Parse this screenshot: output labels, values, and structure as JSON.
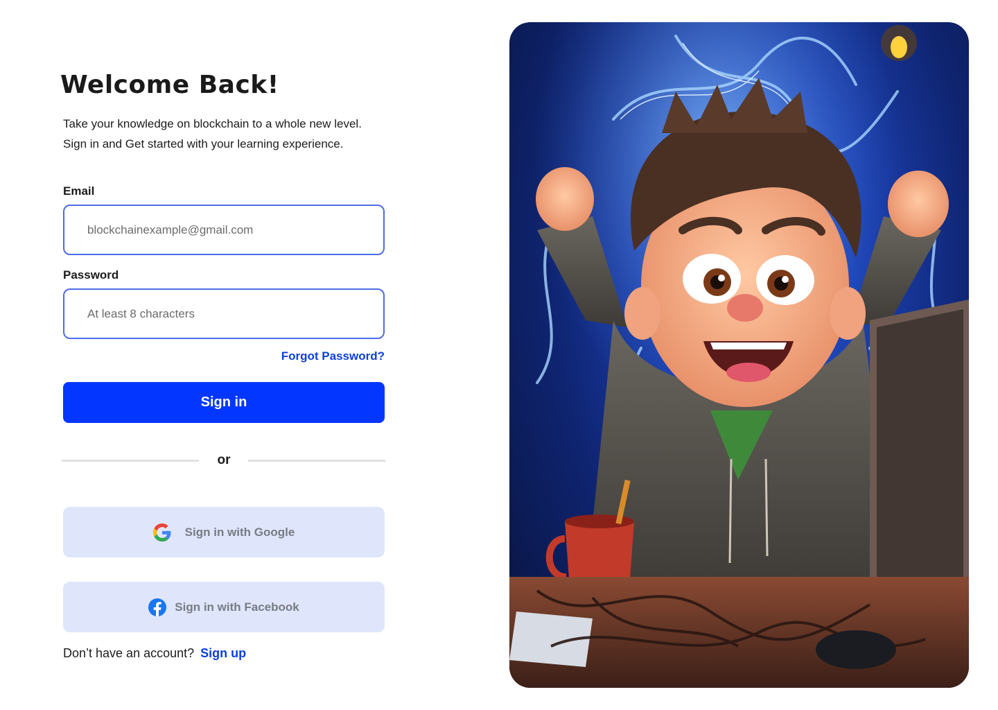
{
  "login": {
    "title": "Welcome Back!",
    "subtitle_line1": "Take your knowledge on blockchain to a whole new level.",
    "subtitle_line2": "Sign in and Get started with your learning  experience.",
    "email_label": "Email",
    "email_placeholder": "blockchainexample@gmail.com",
    "password_label": "Password",
    "password_placeholder": "At least 8 characters",
    "forgot_password": "Forgot Password?",
    "signin_button": "Sign in",
    "divider_text": "or",
    "google_button": "Sign in with Google",
    "facebook_button": "Sign in with Facebook",
    "no_account_text": "Don’t have an account?",
    "signup_link": "Sign up"
  },
  "icons": {
    "google": "google-logo-icon",
    "facebook": "facebook-logo-icon"
  },
  "colors": {
    "primary": "#0336ff",
    "link": "#0b3fe0",
    "field_border": "#4e6ce6",
    "social_bg": "#dfe6fb",
    "facebook_blue": "#1877f2"
  }
}
